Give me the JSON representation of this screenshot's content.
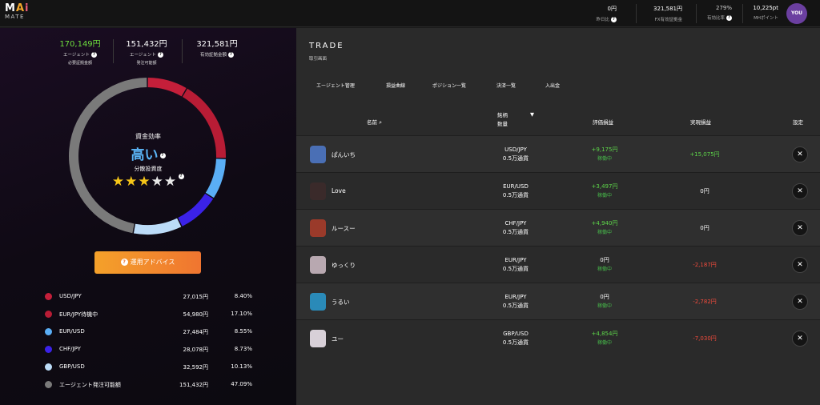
{
  "header": {
    "logo_main": "MAi",
    "logo_sub": "MATE",
    "stats": [
      {
        "value": "0円",
        "label": "昨日比"
      },
      {
        "value": "321,581円",
        "label": "FX有効証拠金"
      },
      {
        "value": "279%",
        "label": "有効比率"
      },
      {
        "value": "10,225pt",
        "label": "MHポイント"
      }
    ],
    "avatar_label": "YOU"
  },
  "left": {
    "summary": [
      {
        "value": "170,149円",
        "label": "エージェント",
        "sub": "必要証拠金額"
      },
      {
        "value": "151,432円",
        "label": "エージェント",
        "sub": "発注可能額"
      },
      {
        "value": "321,581円",
        "label": "有効証拠金額",
        "sub": ""
      }
    ],
    "center_title": "資金効率",
    "center_value": "高い",
    "center_sub": "分散投資度",
    "stars_filled": 3,
    "stars_total": 5,
    "advice_label": "運用アドバイス",
    "legend": [
      {
        "name": "USD/JPY",
        "amount": "27,015円",
        "pct": "8.40%",
        "color": "#c41f3a"
      },
      {
        "name": "EUR/JPY待機中",
        "amount": "54,980円",
        "pct": "17.10%",
        "color": "#b81c35"
      },
      {
        "name": "EUR/USD",
        "amount": "27,484円",
        "pct": "8.55%",
        "color": "#5aaef5"
      },
      {
        "name": "CHF/JPY",
        "amount": "28,078円",
        "pct": "8.73%",
        "color": "#3b22e8"
      },
      {
        "name": "GBP/USD",
        "amount": "32,592円",
        "pct": "10.13%",
        "color": "#bcdcf8"
      },
      {
        "name": "エージェント発注可能額",
        "amount": "151,432円",
        "pct": "47.09%",
        "color": "#7a7a7a"
      }
    ]
  },
  "chart_data": {
    "type": "pie",
    "categories": [
      "USD/JPY",
      "EUR/JPY待機中",
      "EUR/USD",
      "CHF/JPY",
      "GBP/USD",
      "エージェント発注可能額"
    ],
    "values": [
      8.4,
      17.1,
      8.55,
      8.73,
      10.13,
      47.09
    ],
    "title": "",
    "legend": "bottom"
  },
  "trade": {
    "title": "TRADE",
    "subtitle": "取引画面",
    "tabs": [
      "エージェント管理",
      "損益曲線",
      "ポジション一覧",
      "決済一覧",
      "入出金"
    ],
    "headers": {
      "name": "名前",
      "pair": "銘柄",
      "qty": "数量",
      "eval": "評価損益",
      "realized": "実現損益",
      "settings": "設定"
    },
    "rows": [
      {
        "name": "ぱんいち",
        "pair": "USD/JPY",
        "qty": "0.5万通貨",
        "eval": "+9,175円",
        "status": "稼働中",
        "eval_color": "g",
        "realized": "+15,075円",
        "real_color": "g",
        "avatar": "#4a6fb5"
      },
      {
        "name": "Love",
        "pair": "EUR/USD",
        "qty": "0.5万通貨",
        "eval": "+3,497円",
        "status": "稼働中",
        "eval_color": "g",
        "realized": "0円",
        "real_color": "w",
        "avatar": "#3a2a2a"
      },
      {
        "name": "ルースー",
        "pair": "CHF/JPY",
        "qty": "0.5万通貨",
        "eval": "+4,940円",
        "status": "稼働中",
        "eval_color": "g",
        "realized": "0円",
        "real_color": "w",
        "avatar": "#9a3a2a"
      },
      {
        "name": "ゆっくり",
        "pair": "EUR/JPY",
        "qty": "0.5万通貨",
        "eval": "0円",
        "status": "稼働中",
        "eval_color": "w",
        "realized": "-2,187円",
        "real_color": "r",
        "avatar": "#b8a8b0"
      },
      {
        "name": "うるい",
        "pair": "EUR/JPY",
        "qty": "0.5万通貨",
        "eval": "0円",
        "status": "稼働中",
        "eval_color": "w",
        "realized": "-2,782円",
        "real_color": "r",
        "avatar": "#2a8ab8"
      },
      {
        "name": "ユー",
        "pair": "GBP/USD",
        "qty": "0.5万通貨",
        "eval": "+4,854円",
        "status": "稼働中",
        "eval_color": "g",
        "realized": "-7,030円",
        "real_color": "r",
        "avatar": "#d8d0d8"
      }
    ]
  }
}
